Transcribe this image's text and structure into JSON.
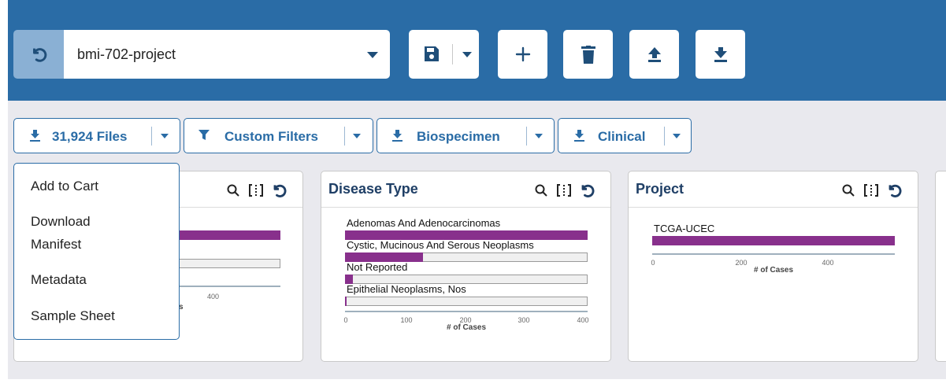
{
  "toolbar": {
    "project_name": "bmi-702-project",
    "colors": {
      "bar": "#2a6ca6",
      "button": "#ffffff",
      "accent": "#88308c"
    },
    "icons": [
      "undo-icon",
      "save-icon",
      "plus-icon",
      "trash-icon",
      "upload-icon",
      "download-icon"
    ]
  },
  "download_bar": {
    "files_label": "31,924 Files",
    "custom_filters_label": "Custom Filters",
    "biospecimen_label": "Biospecimen",
    "clinical_label": "Clinical"
  },
  "dropdown": {
    "items": [
      "Add to Cart",
      "Download\nManifest",
      "Metadata",
      "Sample Sheet"
    ]
  },
  "cards": {
    "partial": {
      "tick_400": "400",
      "fragment": "s"
    },
    "disease_type": {
      "title": "Disease Type",
      "chart_data": {
        "type": "bar",
        "orientation": "horizontal",
        "categories": [
          "Adenomas And Adenocarcinomas",
          "Cystic, Mucinous And Serous Neoplasms",
          "Not Reported",
          "Epithelial Neoplasms, Nos"
        ],
        "values": [
          412,
          132,
          13,
          3
        ],
        "xlabel": "# of Cases",
        "xlim": [
          0,
          412
        ],
        "ticks": [
          "0",
          "100",
          "200",
          "300",
          "400"
        ]
      }
    },
    "project": {
      "title": "Project",
      "chart_data": {
        "type": "bar",
        "orientation": "horizontal",
        "categories": [
          "TCGA-UCEC"
        ],
        "values": [
          560
        ],
        "xlabel": "# of Cases",
        "xlim": [
          0,
          560
        ],
        "ticks": [
          "0",
          "200",
          "400"
        ]
      }
    }
  }
}
